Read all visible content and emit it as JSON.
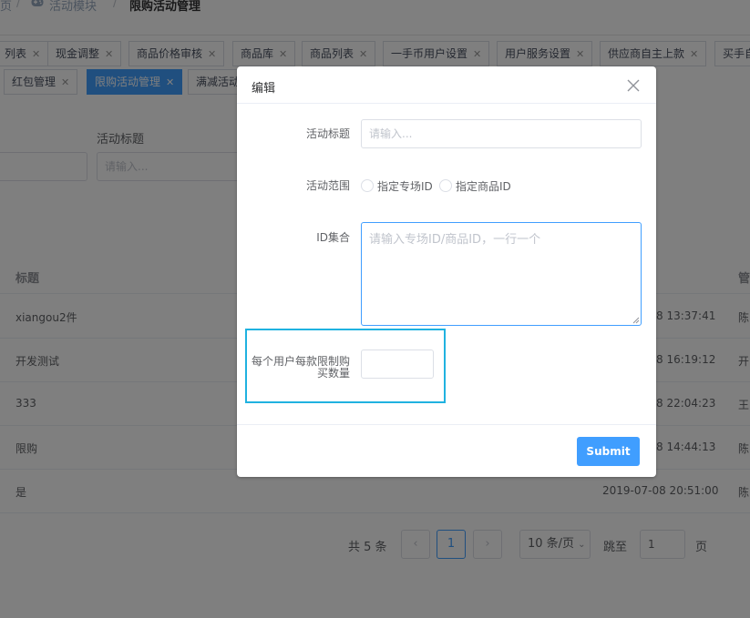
{
  "breadcrumb": {
    "item0": "页",
    "sep": "/",
    "module": "活动模块",
    "current": "限购活动管理"
  },
  "tags": [
    {
      "label": "列表"
    },
    {
      "label": "现金调整"
    },
    {
      "label": "商品价格审核"
    },
    {
      "label": "商品库"
    },
    {
      "label": "商品列表"
    },
    {
      "label": "一手币用户设置"
    },
    {
      "label": "用户服务设置"
    },
    {
      "label": "供应商自主上款"
    },
    {
      "label": "买手自"
    },
    {
      "label": "红包管理"
    },
    {
      "label": "限购活动管理"
    },
    {
      "label": "满减活动"
    }
  ],
  "filter": {
    "title_label": "活动标题",
    "title_placeholder": "请输入..."
  },
  "table": {
    "col_title": "标题",
    "col_manage": "管",
    "rows": [
      {
        "title": "xiangou2件",
        "time": "8 13:37:41",
        "manager": "陈"
      },
      {
        "title": "开发测试",
        "time": "8 16:19:12",
        "manager": "开"
      },
      {
        "title": "333",
        "time": "8 22:04:23",
        "manager": "王"
      },
      {
        "title": "限购",
        "time": "8 14:44:13",
        "manager": "陈"
      },
      {
        "title": "是",
        "time": "2019-07-08 20:51:00",
        "manager": "陈"
      }
    ]
  },
  "pager": {
    "total": "共 5 条",
    "prev": "‹",
    "page": "1",
    "next": "›",
    "size": "10 条/页",
    "jump_label": "跳至",
    "jump_value": "1",
    "page_unit": "页"
  },
  "dialog": {
    "title": "编辑",
    "field_title_label": "活动标题",
    "field_title_placeholder": "请输入...",
    "field_scope_label": "活动范围",
    "radio_special": "指定专场ID",
    "radio_product": "指定商品ID",
    "field_ids_label": "ID集合",
    "field_ids_placeholder": "请输入专场ID/商品ID，一行一个",
    "field_limit_label_line1": "每个用户每款限制购",
    "field_limit_label_line2": "买数量",
    "submit": "Submit"
  },
  "colors": {
    "primary": "#409eff",
    "highlight": "#20b2e0"
  },
  "icons": {
    "close": "close-icon",
    "tag_close": "tag-close-icon",
    "breadcrumb_game": "gamepad-icon"
  }
}
